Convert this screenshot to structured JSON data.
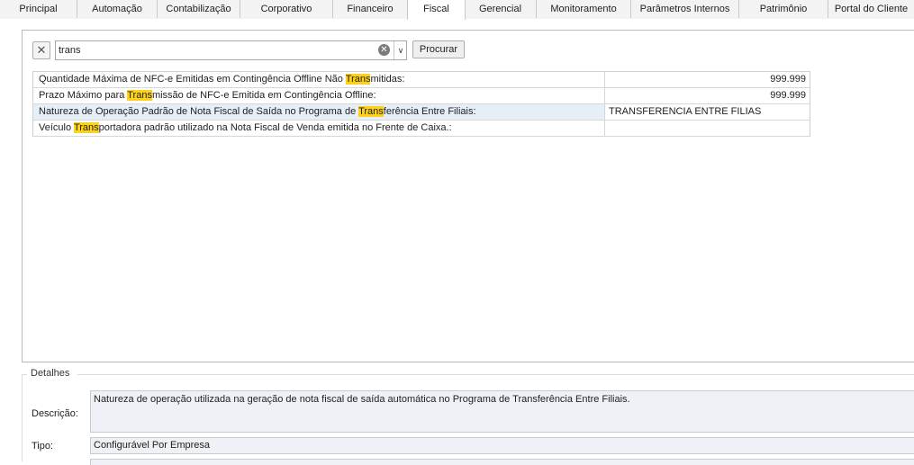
{
  "tabs": [
    {
      "label": "Principal"
    },
    {
      "label": "Automação"
    },
    {
      "label": "Contabilização"
    },
    {
      "label": "Corporativo"
    },
    {
      "label": "Financeiro"
    },
    {
      "label": "Fiscal"
    },
    {
      "label": "Gerencial"
    },
    {
      "label": "Monitoramento"
    },
    {
      "label": "Parâmetros Internos"
    },
    {
      "label": "Patrimônio"
    },
    {
      "label": "Portal do Cliente"
    }
  ],
  "active_tab": "Fiscal",
  "search": {
    "value": "trans",
    "button_label": "Procurar",
    "clear_button_glyph": "✕",
    "clear_icon_glyph": "✕",
    "dropdown_glyph": "∨"
  },
  "results": [
    {
      "name_pre": "Quantidade Máxima de NFC-e Emitidas em Contingência Offline Não ",
      "name_hl": "Trans",
      "name_post": "mitidas:",
      "value": "999.999"
    },
    {
      "name_pre": "Prazo Máximo para ",
      "name_hl": "Trans",
      "name_post": "missão de NFC-e Emitida em Contingência Offline:",
      "value": "999.999"
    },
    {
      "name_pre": "Natureza de Operação Padrão de Nota Fiscal de Saída no Programa de ",
      "name_hl": "Trans",
      "name_post": "ferência Entre Filiais:",
      "value": "TRANSFERENCIA ENTRE FILIAS"
    },
    {
      "name_pre": "Veículo ",
      "name_hl": "Trans",
      "name_post": "portadora padrão utilizado na Nota Fiscal de Venda emitida no Frente de Caixa.:",
      "value": ""
    }
  ],
  "details": {
    "title": "Detalhes",
    "description_label": "Descrição:",
    "description_value": "Natureza de operação utilizada na geração de nota fiscal de saída automática no Programa de Transferência Entre Filiais.",
    "type_label": "Tipo:",
    "type_value": "Configurável Por Empresa"
  },
  "colors": {
    "highlight": "#ffd21a",
    "selected_row": "#e6eff8"
  }
}
